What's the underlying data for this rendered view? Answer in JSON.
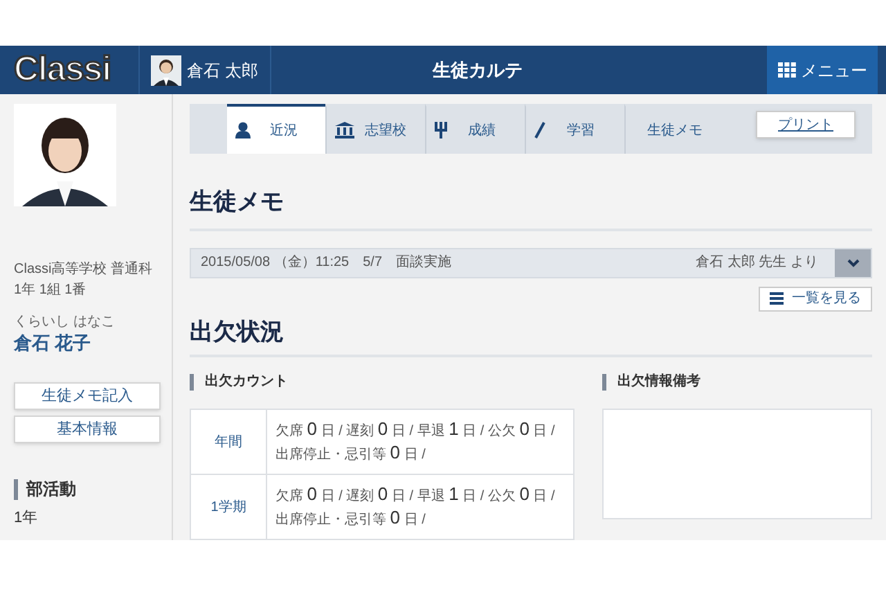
{
  "header": {
    "logo": "Classi",
    "user_name": "倉石 太郎",
    "title": "生徒カルテ",
    "menu_button": "メニュー"
  },
  "sidebar": {
    "school": "Classi高等学校 普通科",
    "class": "1年 1組 1番",
    "reading": "くらいし はなこ",
    "student_name": "倉石 花子",
    "buttons": [
      "生徒メモ記入",
      "基本情報"
    ],
    "club_heading": "部活動",
    "club_year": "1年"
  },
  "tabs": [
    {
      "label": "近況",
      "selected": true
    },
    {
      "label": "志望校",
      "selected": false
    },
    {
      "label": "成績",
      "selected": false
    },
    {
      "label": "学習",
      "selected": false
    },
    {
      "label": "生徒メモ",
      "selected": false
    }
  ],
  "print_button": "プリント",
  "memo": {
    "heading": "生徒メモ",
    "date": "2015/05/08 （金）11:25",
    "text": "5/7　面談実施",
    "author": "倉石 太郎 先生 より",
    "list_button": "一覧を見る"
  },
  "attendance": {
    "heading": "出欠状況",
    "count_heading": "出欠カウント",
    "notes_heading": "出欠情報備考",
    "rows": [
      {
        "period": "年間",
        "items": [
          {
            "label": "欠席",
            "count": "0",
            "unit": "日 /"
          },
          {
            "label": "遅刻",
            "count": "0",
            "unit": "日 /"
          },
          {
            "label": "早退",
            "count": "1",
            "unit": "日 /"
          },
          {
            "label": "公欠",
            "count": "0",
            "unit": "日 /"
          },
          {
            "label": "出席停止・忌引等",
            "count": "0",
            "unit": "日 /"
          }
        ]
      },
      {
        "period": "1学期",
        "items": [
          {
            "label": "欠席",
            "count": "0",
            "unit": "日 /"
          },
          {
            "label": "遅刻",
            "count": "0",
            "unit": "日 /"
          },
          {
            "label": "早退",
            "count": "1",
            "unit": "日 /"
          },
          {
            "label": "公欠",
            "count": "0",
            "unit": "日 /"
          },
          {
            "label": "出席停止・忌引等",
            "count": "0",
            "unit": "日 /"
          }
        ]
      }
    ]
  }
}
